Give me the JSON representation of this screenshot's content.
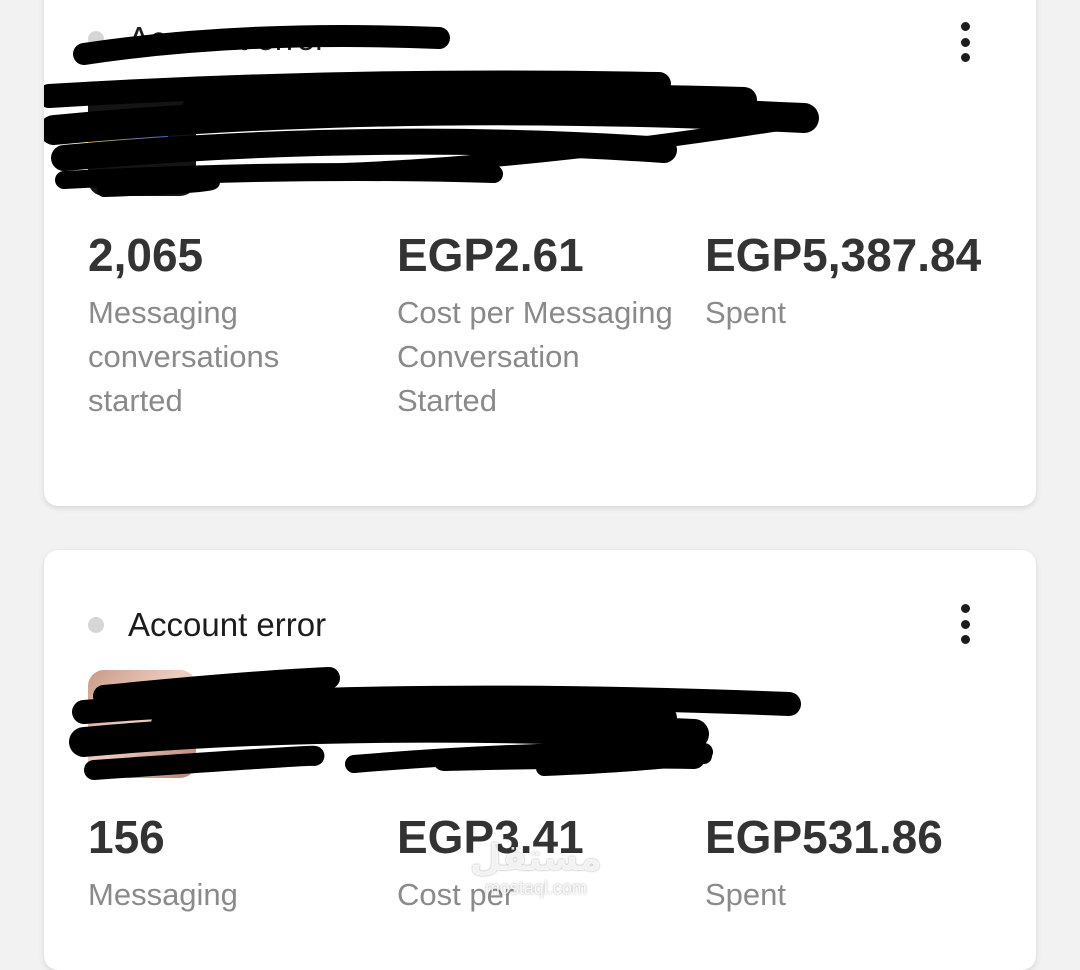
{
  "cards": [
    {
      "status": "Account error",
      "metrics": [
        {
          "value": "2,065",
          "label": "Messaging conversations started"
        },
        {
          "value": "EGP2.61",
          "label": "Cost per Messaging Conversation Started"
        },
        {
          "value": "EGP5,387.84",
          "label": "Spent"
        }
      ]
    },
    {
      "status": "Account error",
      "metrics": [
        {
          "value": "156",
          "label": "Messaging"
        },
        {
          "value": "EGP3.41",
          "label": "Cost per"
        },
        {
          "value": "EGP531.86",
          "label": "Spent"
        }
      ]
    }
  ],
  "watermark": {
    "arabic": "مستقل",
    "latin": "mostaql.com"
  },
  "icons": {
    "menu": "more-vertical-icon",
    "status": "status-dot-icon"
  },
  "colors": {
    "status_dot": "#d6d6d6",
    "value_text": "#333333",
    "label_text": "#8a8a8a",
    "redaction": "#000000"
  }
}
